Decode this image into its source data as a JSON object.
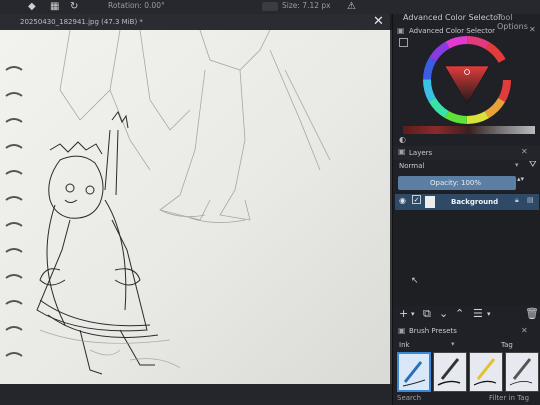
{
  "toolbar": {
    "icons": [
      "eraser-icon",
      "checker-icon",
      "reload-icon"
    ],
    "rotation_label": "Rotation: 0.00°",
    "size_label": "Size: 7.12 px",
    "warn_glyph": "⚠"
  },
  "document": {
    "tab_title": "20250430_182941.jpg (47.3 MiB) *",
    "close_glyph": "✕"
  },
  "right_tabs": {
    "advanced_color_selector": "Advanced Color Selector",
    "tool_options": "Tool Options"
  },
  "color_selector": {
    "title": "Advanced Color Selector",
    "selected_color": "#c8232a"
  },
  "layers": {
    "title": "Layers",
    "blend_mode": "Normal",
    "opacity_label": "Opacity: 100%",
    "items": [
      {
        "name": "Background",
        "visible": true,
        "selected": true
      }
    ]
  },
  "brush_presets": {
    "title": "Brush Presets",
    "tag_filter": "Ink",
    "tag_label": "Tag",
    "search_placeholder": "Search",
    "filter_in_tag": "Filter in Tag",
    "selected_index": 0
  },
  "accent_color": "#5b7ea3"
}
